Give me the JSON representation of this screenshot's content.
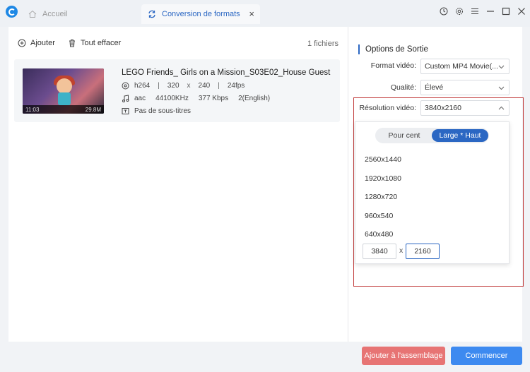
{
  "titlebar": {
    "home_tab": "Accueil",
    "active_tab": "Conversion de formats",
    "close_glyph": "×",
    "icons": [
      "history-icon",
      "settings-icon",
      "menu-icon",
      "minimize-icon",
      "maximize-icon",
      "close-icon"
    ]
  },
  "toolbar": {
    "add_label": "Ajouter",
    "clear_label": "Tout effacer",
    "files_count": "1 fichiers"
  },
  "file": {
    "title": "LEGO Friends_ Girls on a Mission_S03E02_House Guest",
    "video_codec": "h264",
    "width": "320",
    "x": "x",
    "height": "240",
    "fps": "24fps",
    "audio_codec": "aac",
    "sample_rate": "44100KHz",
    "bitrate": "377 Kbps",
    "channels": "2(English)",
    "subtitles": "Pas de sous-titres",
    "duration": "11:03",
    "size": "29.8M",
    "sep": "|"
  },
  "options": {
    "title": "Options de Sortie",
    "format_label": "Format vidéo:",
    "format_value": "Custom MP4 Movie(...",
    "quality_label": "Qualité:",
    "quality_value": "Élevé",
    "resolution_label": "Résolution vidéo:",
    "resolution_value": "3840x2160"
  },
  "resolution_dropdown": {
    "mode_percent": "Pour cent",
    "mode_size": "Large * Haut",
    "items": [
      "2560x1440",
      "1920x1080",
      "1280x720",
      "960x540",
      "640x480"
    ],
    "custom_width": "3840",
    "custom_x": "x",
    "custom_height": "2160"
  },
  "buttons": {
    "assemble": "Ajouter à l'assemblage",
    "start": "Commencer"
  },
  "colors": {
    "accent": "#2b67c3",
    "assemble_bg": "#e77474",
    "start_bg": "#3d8af0",
    "highlight_box": "#c03a3a"
  }
}
